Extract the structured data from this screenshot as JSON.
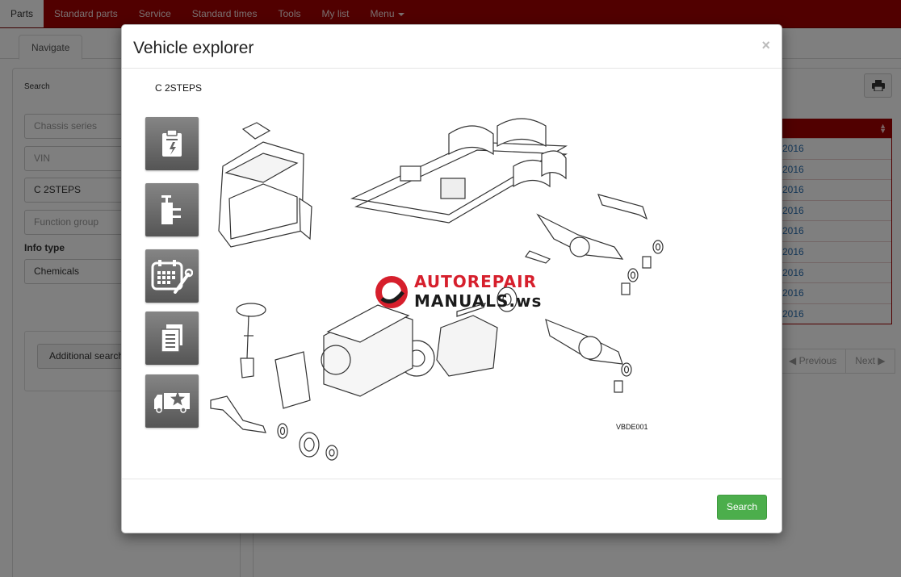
{
  "topnav": {
    "items": [
      "Parts",
      "Standard parts",
      "Service",
      "Standard times",
      "Tools",
      "My list",
      "Menu"
    ],
    "active": "Parts"
  },
  "tabs": {
    "navigate": "Navigate"
  },
  "search_panel": {
    "title": "Search",
    "chassis_series_placeholder": "Chassis series",
    "vin_placeholder": "VIN",
    "model_value": "C 2STEPS",
    "function_group_placeholder": "Function group",
    "info_type_label": "Info type",
    "info_type_value": "Chemicals",
    "additional_search": "Additional search"
  },
  "results": {
    "rows": [
      "2016",
      "2016",
      "2016",
      "2016",
      "2016",
      "2016",
      "2016",
      "2016",
      "2016"
    ],
    "previous": "Previous",
    "next": "Next"
  },
  "modal": {
    "title": "Vehicle explorer",
    "close": "×",
    "model": "C 2STEPS",
    "diagram_code": "VBDE001",
    "search_button": "Search",
    "categories": [
      "electrical-icon",
      "hydraulic-icon",
      "maintenance-schedule-icon",
      "document-list-icon",
      "truck-favorite-icon"
    ]
  },
  "watermark": {
    "line1": "AUTOREPAIR",
    "line2": "MANUALS.ws"
  },
  "colors": {
    "brand_red": "#a30000",
    "link_blue": "#2a6fb0",
    "success_green": "#4cae4c"
  }
}
